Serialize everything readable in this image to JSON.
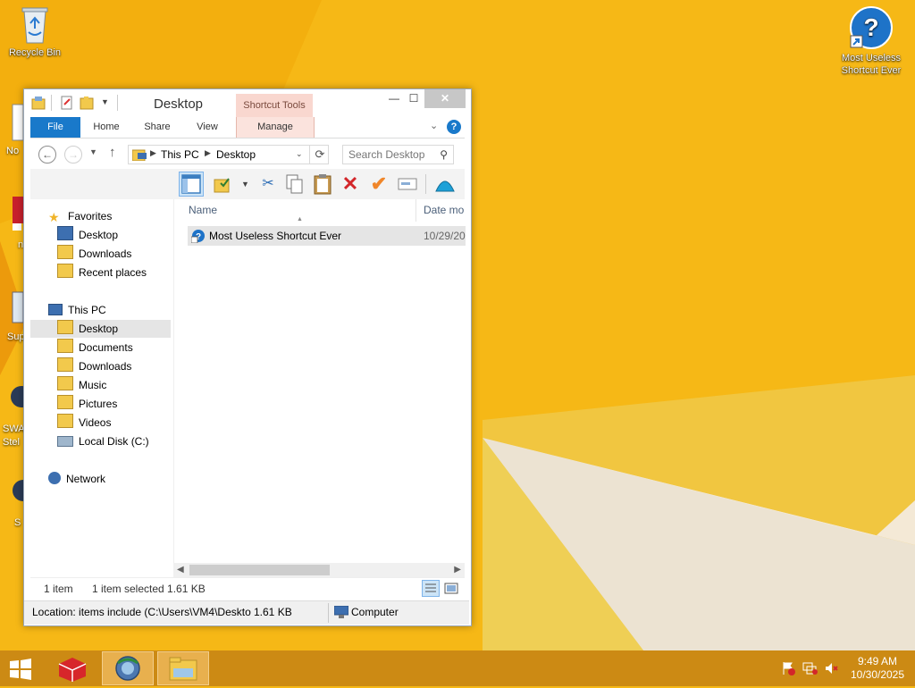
{
  "desktop": {
    "recycle_bin": "Recycle Bin",
    "shortcut_line1": "Most Useless",
    "shortcut_line2": "Shortcut Ever",
    "edge_labels": [
      "No",
      "n",
      "Sup",
      "SWA",
      "Stel",
      "S"
    ]
  },
  "window": {
    "title": "Desktop",
    "contextual_tab_group": "Shortcut Tools",
    "minimize": "—",
    "maximize": "☐",
    "close": "✕"
  },
  "ribbon": {
    "tabs": [
      "File",
      "Home",
      "Share",
      "View",
      "Manage"
    ],
    "help": "?"
  },
  "navigation": {
    "back": "←",
    "forward": "→",
    "up": "↑",
    "path": [
      "This PC",
      "Desktop"
    ],
    "search_placeholder": "Search Desktop"
  },
  "nav_pane": {
    "favorites": "Favorites",
    "favorites_items": [
      "Desktop",
      "Downloads",
      "Recent places"
    ],
    "this_pc": "This PC",
    "this_pc_items": [
      "Desktop",
      "Documents",
      "Downloads",
      "Music",
      "Pictures",
      "Videos",
      "Local Disk (C:)"
    ],
    "network": "Network",
    "selected": "Desktop"
  },
  "file_list": {
    "columns": [
      "Name",
      "Date mo"
    ],
    "rows": [
      {
        "name": "Most Useless Shortcut Ever",
        "date": "10/29/20"
      }
    ]
  },
  "status": {
    "item_count": "1 item",
    "selection": "1 item selected  1.61 KB"
  },
  "details_bar": {
    "location": "Location: items include (C:\\Users\\VM4\\Deskto",
    "size": "1.61 KB",
    "computer": "Computer"
  },
  "taskbar": {
    "time": "9:49 AM",
    "date": "10/30/2025"
  },
  "colors": {
    "desktop": "#f6b816",
    "taskbar": "#cc8a14",
    "file_tab": "#1979ca",
    "contextual_tab": "#f9d7cf",
    "selection": "#e5e5e5"
  }
}
